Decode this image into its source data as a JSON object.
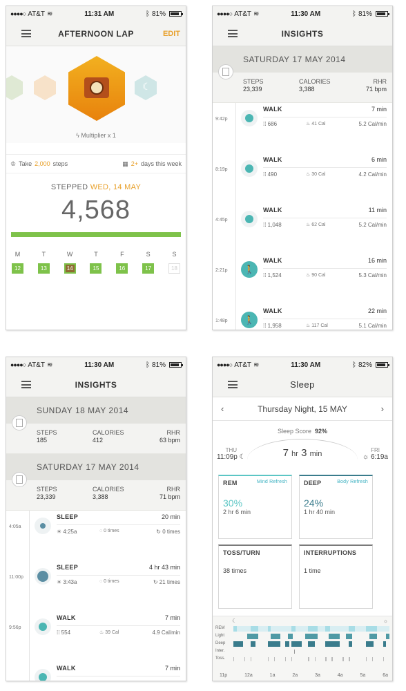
{
  "status": {
    "p1": {
      "carrier": "AT&T",
      "time": "11:31 AM",
      "battery": "81%"
    },
    "p2": {
      "carrier": "AT&T",
      "time": "11:30 AM",
      "battery": "81%"
    },
    "p3": {
      "carrier": "AT&T",
      "time": "11:30 AM",
      "battery": "81%"
    },
    "p4": {
      "carrier": "AT&T",
      "time": "11:30 AM",
      "battery": "82%"
    }
  },
  "lap": {
    "title": "AFTERNOON LAP",
    "edit_label": "EDIT",
    "multiplier": "Multiplier x 1",
    "goal_prefix": "Take",
    "goal_steps": "2,000",
    "goal_suffix": "steps",
    "days_accent": "2+",
    "days_text": "days this week",
    "stepped_label": "STEPPED",
    "stepped_date": "WED, 14 MAY",
    "steps": "4,568",
    "progress_fraction": 1.0,
    "weekdays": [
      "M",
      "T",
      "W",
      "T",
      "F",
      "S",
      "S"
    ],
    "dates": [
      "12",
      "13",
      "14",
      "15",
      "16",
      "17",
      "18"
    ]
  },
  "insights_a": {
    "title": "INSIGHTS",
    "day": {
      "weekday": "SATURDAY",
      "date": "17 MAY 2014",
      "steps_label": "STEPS",
      "steps": "23,339",
      "cal_label": "CALORIES",
      "cal": "3,388",
      "rhr_label": "RHR",
      "rhr": "71 bpm"
    },
    "activities": [
      {
        "time": "9:42p",
        "name": "WALK",
        "dur": "7 min",
        "m1": "686",
        "m2": "41 Cal",
        "m3": "5.2 Cal/min",
        "kind": "dot"
      },
      {
        "time": "8:19p",
        "name": "WALK",
        "dur": "6 min",
        "m1": "490",
        "m2": "30 Cal",
        "m3": "4.2 Cal/min",
        "kind": "dot"
      },
      {
        "time": "4:45p",
        "name": "WALK",
        "dur": "11 min",
        "m1": "1,048",
        "m2": "62 Cal",
        "m3": "5.2 Cal/min",
        "kind": "dot"
      },
      {
        "time": "2:21p",
        "name": "WALK",
        "dur": "16 min",
        "m1": "1,524",
        "m2": "90 Cal",
        "m3": "5.3 Cal/min",
        "kind": "person"
      },
      {
        "time": "1:48p",
        "name": "WALK",
        "dur": "22 min",
        "m1": "1,958",
        "m2": "117 Cal",
        "m3": "5.1 Cal/min",
        "kind": "person"
      }
    ]
  },
  "insights_b": {
    "title": "INSIGHTS",
    "day1": {
      "weekday": "SUNDAY",
      "date": "18 MAY 2014",
      "steps_label": "STEPS",
      "steps": "185",
      "cal_label": "CALORIES",
      "cal": "412",
      "rhr_label": "RHR",
      "rhr": "63 bpm"
    },
    "day2": {
      "weekday": "SATURDAY",
      "date": "17 MAY 2014",
      "steps_label": "STEPS",
      "steps": "23,339",
      "cal_label": "CALORIES",
      "cal": "3,388",
      "rhr_label": "RHR",
      "rhr": "71 bpm"
    },
    "activities": [
      {
        "time": "4:05a",
        "name": "SLEEP",
        "dur": "20 min",
        "m1": "4:25a",
        "m2": "0 times",
        "m3": "0 times",
        "kind": "sm"
      },
      {
        "time": "11:00p",
        "name": "SLEEP",
        "dur": "4 hr 43 min",
        "m1": "3:43a",
        "m2": "0 times",
        "m3": "21 times",
        "kind": "lg"
      },
      {
        "time": "9:56p",
        "name": "WALK",
        "dur": "7 min",
        "m1": "554",
        "m2": "39 Cal",
        "m3": "4.9 Cal/min",
        "kind": "dot"
      },
      {
        "time": "",
        "name": "WALK",
        "dur": "7 min",
        "m1": "",
        "m2": "",
        "m3": "",
        "kind": "dot"
      }
    ]
  },
  "sleep": {
    "title": "Sleep",
    "night": "Thursday Night,",
    "night_date": "15 MAY",
    "score_label": "Sleep Score",
    "score": "92%",
    "start_day": "THU",
    "start_time": "11:09p",
    "end_day": "FRI",
    "end_time": "6:19a",
    "total_hr": "7",
    "hr_unit": "hr",
    "total_min": "3",
    "min_unit": "min",
    "rem": {
      "label": "REM",
      "sub": "Mind Refresh",
      "pct": "30%",
      "dur": "2 hr  6 min"
    },
    "deep": {
      "label": "DEEP",
      "sub": "Body Refresh",
      "pct": "24%",
      "dur": "1 hr  40 min"
    },
    "toss": {
      "label": "TOSS/TURN",
      "value": "38 times"
    },
    "inter": {
      "label": "INTERRUPTIONS",
      "value": "1 time"
    },
    "graph_labels": [
      "REM",
      "Light",
      "Deep",
      "Inter.",
      "Toss."
    ],
    "hours": [
      "11p",
      "12a",
      "1a",
      "2a",
      "3a",
      "4a",
      "5a",
      "6a"
    ]
  },
  "colors": {
    "accent": "#e8a02a",
    "green": "#7ec24a",
    "teal": "#4bb6b3"
  }
}
